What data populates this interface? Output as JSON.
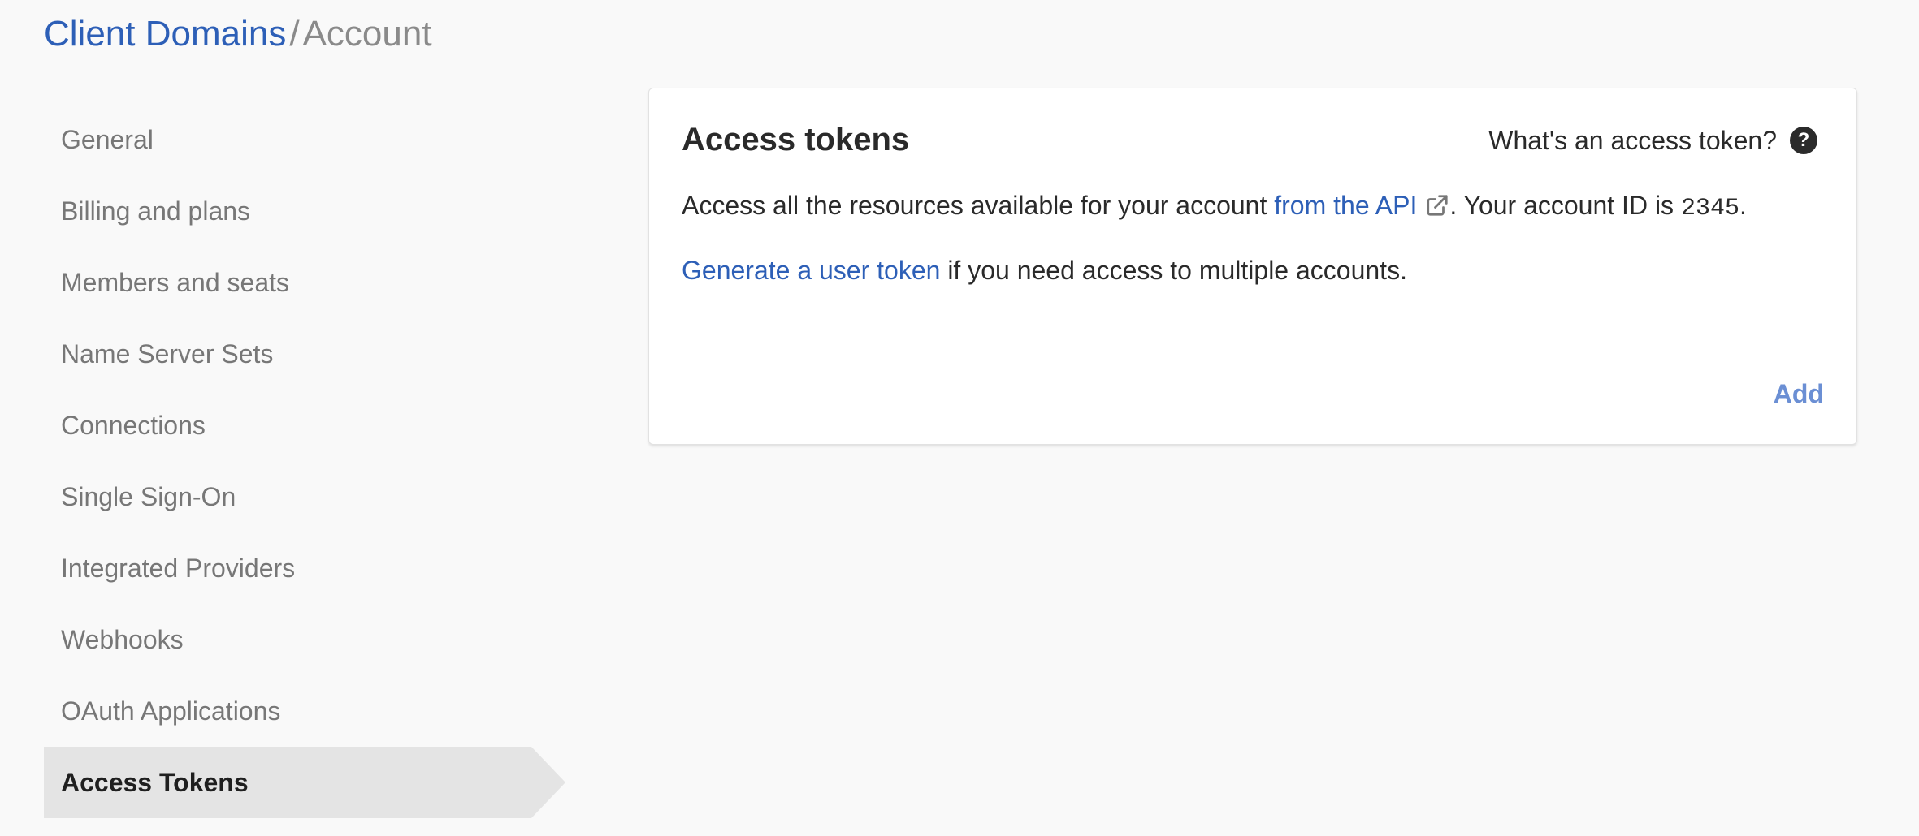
{
  "breadcrumb": {
    "parent": "Client Domains",
    "separator": "/",
    "current": "Account"
  },
  "sidebar": {
    "items": [
      {
        "label": "General"
      },
      {
        "label": "Billing and plans"
      },
      {
        "label": "Members and seats"
      },
      {
        "label": "Name Server Sets"
      },
      {
        "label": "Connections"
      },
      {
        "label": "Single Sign-On"
      },
      {
        "label": "Integrated Providers"
      },
      {
        "label": "Webhooks"
      },
      {
        "label": "OAuth Applications"
      },
      {
        "label": "Access Tokens",
        "active": true
      }
    ]
  },
  "card": {
    "title": "Access tokens",
    "help_text": "What's an access token?",
    "help_icon": "question-circle-icon",
    "line1_prefix": "Access all the resources available for your account ",
    "line1_link": "from the API",
    "line1_link_icon": "external-link-icon",
    "line1_middle": ". Your account ID is ",
    "account_id": "2345",
    "line1_suffix": ".",
    "line2_link": "Generate a user token",
    "line2_rest": " if you need access to multiple accounts.",
    "add_label": "Add"
  },
  "colors": {
    "link": "#2d5fb7",
    "add": "#6b8fd4",
    "active_bg": "#e4e4e4",
    "page_bg": "#f9f9f9"
  }
}
